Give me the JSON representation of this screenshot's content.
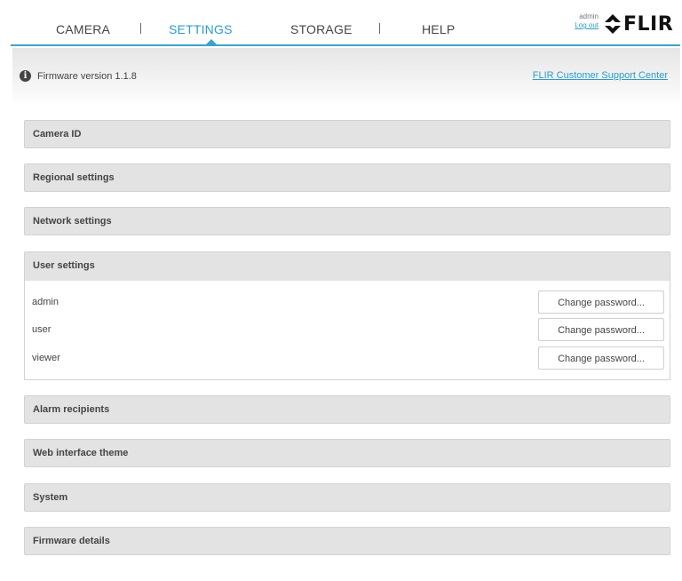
{
  "nav": {
    "tabs": [
      "CAMERA",
      "SETTINGS",
      "STORAGE",
      "HELP"
    ],
    "active_tab": "SETTINGS",
    "user": "admin",
    "logout": "Log out",
    "logo": "FLIR",
    "accent_color": "#2b9cc9"
  },
  "firmware": {
    "version_text": "Firmware version 1.1.8",
    "support_link": "FLIR Customer Support Center"
  },
  "sections": {
    "camera_id": "Camera ID",
    "regional": "Regional settings",
    "network": "Network settings",
    "user_settings": "User settings",
    "alarm": "Alarm recipients",
    "theme": "Web interface theme",
    "system": "System",
    "firmware_details": "Firmware details"
  },
  "users": [
    {
      "name": "admin",
      "button": "Change password..."
    },
    {
      "name": "user",
      "button": "Change password..."
    },
    {
      "name": "viewer",
      "button": "Change password..."
    }
  ]
}
